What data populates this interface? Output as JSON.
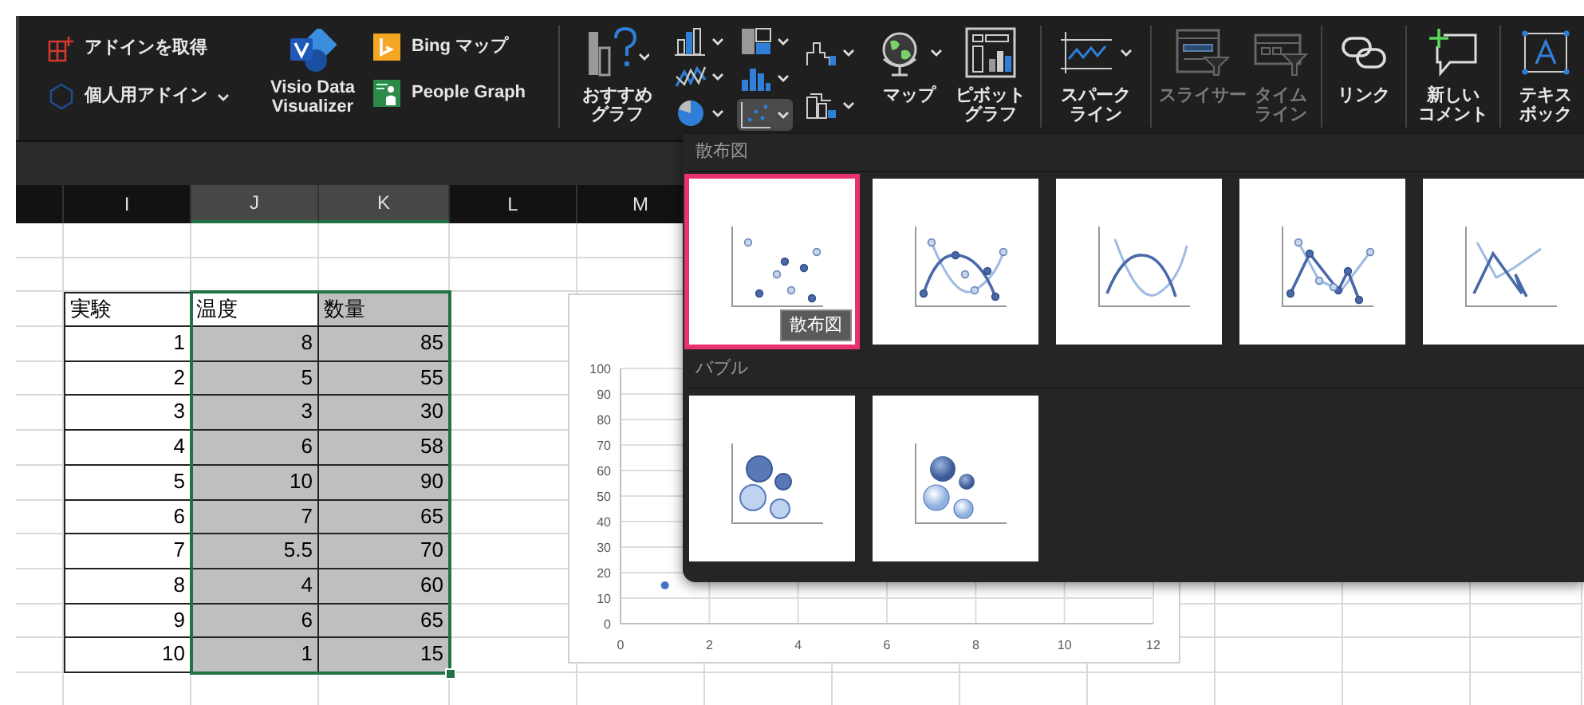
{
  "ribbon": {
    "addins": [
      {
        "kind": "get",
        "label": "アドインを取得",
        "dropdown": false
      },
      {
        "kind": "personal",
        "label": "個人用アドイン",
        "dropdown": true
      }
    ],
    "visio": {
      "label": "Visio Data Visualizer"
    },
    "apps": [
      {
        "kind": "bing",
        "label": "Bing マップ"
      },
      {
        "kind": "people",
        "label": "People Graph"
      }
    ],
    "recommended": {
      "lines": [
        "おすすめ",
        "グラフ"
      ]
    },
    "chart_type_columns": [
      [
        {
          "kind": "column",
          "selected": false
        },
        {
          "kind": "line",
          "selected": false
        },
        {
          "kind": "pie",
          "selected": false
        }
      ],
      [
        {
          "kind": "hierarchy",
          "selected": false
        },
        {
          "kind": "statistic",
          "selected": false
        },
        {
          "kind": "scatter",
          "selected": true
        }
      ],
      [
        {
          "kind": "waterfall",
          "selected": false
        },
        {
          "kind": "combo",
          "selected": false
        }
      ]
    ],
    "tools": [
      {
        "kind": "map",
        "lines": [
          "マップ"
        ],
        "dropdown": true,
        "disabled": false
      },
      {
        "kind": "pivot",
        "lines": [
          "ピボット",
          "グラフ"
        ],
        "dropdown": false,
        "disabled": false
      },
      {
        "kind": "sparkline",
        "lines": [
          "スパーク",
          "ライン"
        ],
        "dropdown": true,
        "disabled": false
      },
      {
        "kind": "slicer",
        "lines": [
          "スライサー"
        ],
        "dropdown": false,
        "disabled": true
      },
      {
        "kind": "timeline",
        "lines": [
          "タイム",
          "ライン"
        ],
        "dropdown": false,
        "disabled": true
      },
      {
        "kind": "link",
        "lines": [
          "リンク"
        ],
        "dropdown": false,
        "disabled": false
      },
      {
        "kind": "comment",
        "lines": [
          "新しい",
          "コメント"
        ],
        "dropdown": false,
        "disabled": false
      },
      {
        "kind": "textbox",
        "lines": [
          "テキス",
          "ボック"
        ],
        "dropdown": false,
        "disabled": false
      }
    ]
  },
  "sheet": {
    "columns": [
      {
        "label": "I",
        "selected": false
      },
      {
        "label": "J",
        "selected": true
      },
      {
        "label": "K",
        "selected": true
      },
      {
        "label": "L",
        "selected": false
      },
      {
        "label": "M",
        "selected": false
      }
    ],
    "table": {
      "columns": [
        {
          "heading": "実験",
          "selected": false
        },
        {
          "heading": "温度",
          "selected": true
        },
        {
          "heading": "数量",
          "selected": true
        }
      ],
      "rows": [
        [
          "1",
          "8",
          "85"
        ],
        [
          "2",
          "5",
          "55"
        ],
        [
          "3",
          "3",
          "30"
        ],
        [
          "4",
          "6",
          "58"
        ],
        [
          "5",
          "10",
          "90"
        ],
        [
          "6",
          "7",
          "65"
        ],
        [
          "7",
          "5.5",
          "70"
        ],
        [
          "8",
          "4",
          "60"
        ],
        [
          "9",
          "6",
          "65"
        ],
        [
          "10",
          "1",
          "15"
        ]
      ]
    },
    "chart": {
      "chart_data": {
        "type": "scatter",
        "grid": true,
        "x": [
          1
        ],
        "series": [
          {
            "color": "#4472c4",
            "values": [
              15
            ]
          }
        ],
        "xlim": [
          0,
          12
        ],
        "ylim": [
          0,
          100
        ],
        "xticks": [
          0,
          2,
          4,
          6,
          8,
          10,
          12
        ],
        "yticks": [
          0,
          10,
          20,
          30,
          40,
          50,
          60,
          70,
          80,
          90,
          100
        ]
      }
    }
  },
  "gallery": {
    "sections": [
      {
        "title": "散布図",
        "options": [
          {
            "kind": "markers",
            "selected": true,
            "tooltip": "散布図"
          },
          {
            "kind": "smooth-markers",
            "selected": false
          },
          {
            "kind": "smooth-lines",
            "selected": false
          },
          {
            "kind": "straight-markers",
            "selected": false
          },
          {
            "kind": "straight-lines",
            "selected": false
          }
        ]
      },
      {
        "title": "バブル",
        "options": [
          {
            "kind": "bubble",
            "selected": false
          },
          {
            "kind": "bubble-3d",
            "selected": false
          }
        ]
      }
    ]
  }
}
